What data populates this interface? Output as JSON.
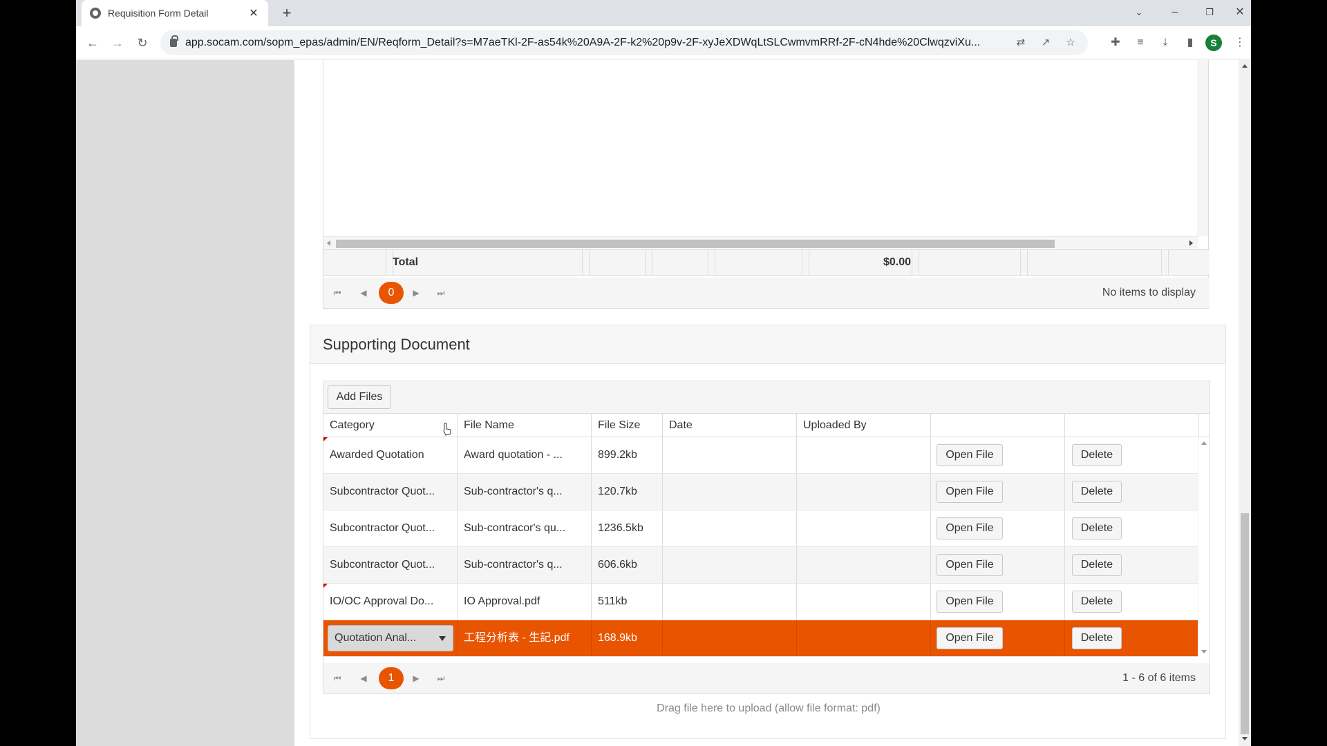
{
  "browser": {
    "tab_title": "Requisition Form Detail",
    "url": "app.socam.com/sopm_epas/admin/EN/Reqform_Detail?s=M7aeTKl-2F-as54k%20A9A-2F-k2%20p9v-2F-xyJeXDWqLtSLCwmvmRRf-2F-cN4hde%20ClwqzviXu...",
    "profile_initial": "S"
  },
  "upper_grid": {
    "total_label": "Total",
    "total_amount": "$0.00",
    "pager": {
      "page": "0",
      "info": "No items to display"
    }
  },
  "supporting_document": {
    "title": "Supporting Document",
    "add_files_label": "Add Files",
    "columns": [
      "Category",
      "File Name",
      "File Size",
      "Date",
      "Uploaded By",
      "",
      ""
    ],
    "open_label": "Open File",
    "delete_label": "Delete",
    "rows": [
      {
        "category": "Awarded Quotation",
        "file_name": "Award quotation - ...",
        "file_size": "899.2kb",
        "date": "",
        "uploaded_by": ""
      },
      {
        "category": "Subcontractor Quot...",
        "file_name": "Sub-contractor's q...",
        "file_size": "120.7kb",
        "date": "",
        "uploaded_by": ""
      },
      {
        "category": "Subcontractor Quot...",
        "file_name": "Sub-contracor's qu...",
        "file_size": "1236.5kb",
        "date": "",
        "uploaded_by": ""
      },
      {
        "category": "Subcontractor Quot...",
        "file_name": "Sub-contractor's q...",
        "file_size": "606.6kb",
        "date": "",
        "uploaded_by": ""
      },
      {
        "category": "IO/OC Approval Do...",
        "file_name": "IO Approval.pdf",
        "file_size": "511kb",
        "date": "",
        "uploaded_by": ""
      },
      {
        "category": "Quotation Anal...",
        "file_name": "工程分析表 - 生記.pdf",
        "file_size": "168.9kb",
        "date": "",
        "uploaded_by": ""
      }
    ],
    "pager": {
      "page": "1",
      "info": "1 - 6 of 6 items"
    },
    "drop_hint": "Drag file here to upload (allow file format: pdf)"
  },
  "colors": {
    "accent": "#e85400",
    "gray_bg": "#dcdcdc"
  }
}
